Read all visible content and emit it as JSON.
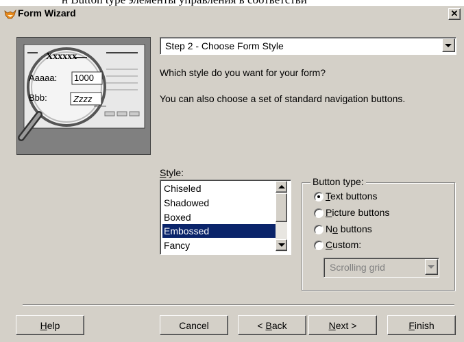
{
  "background_strip_text": "н Button type элементы управления в соответстви",
  "window": {
    "title": "Form Wizard"
  },
  "illustration": {
    "heading": "Xxxxxx",
    "field1_label": "Aaaaa:",
    "field1_value": "1000",
    "field2_label": "Bbb:",
    "field2_value": "Zzzz"
  },
  "step_combo": {
    "value": "Step 2 - Choose Form Style"
  },
  "question": "Which style do you want for your form?",
  "nav_text": "You can also choose a set of standard navigation buttons.",
  "style": {
    "label_mnemonic": "S",
    "label_rest": "tyle:",
    "items": [
      "Chiseled",
      "Shadowed",
      "Boxed",
      "Embossed",
      "Fancy"
    ],
    "selected": "Embossed"
  },
  "button_type": {
    "label": "Button type:",
    "options": [
      {
        "pre": "",
        "mn": "T",
        "post": "ext buttons",
        "checked": true
      },
      {
        "pre": "",
        "mn": "P",
        "post": "icture buttons",
        "checked": false
      },
      {
        "pre": "N",
        "mn": "o",
        "post": " buttons",
        "checked": false
      },
      {
        "pre": "",
        "mn": "C",
        "post": "ustom:",
        "checked": false
      }
    ],
    "custom_combo": "Scrolling grid"
  },
  "buttons": {
    "help_mn": "H",
    "help_rest": "elp",
    "cancel": "Cancel",
    "back_pre": "< ",
    "back_mn": "B",
    "back_rest": "ack",
    "next_mn": "N",
    "next_rest": "ext >",
    "finish_mn": "F",
    "finish_rest": "inish"
  },
  "colors": {
    "face": "#d4d0c8",
    "selection": "#0a246a",
    "illustration_bg": "#808080"
  }
}
